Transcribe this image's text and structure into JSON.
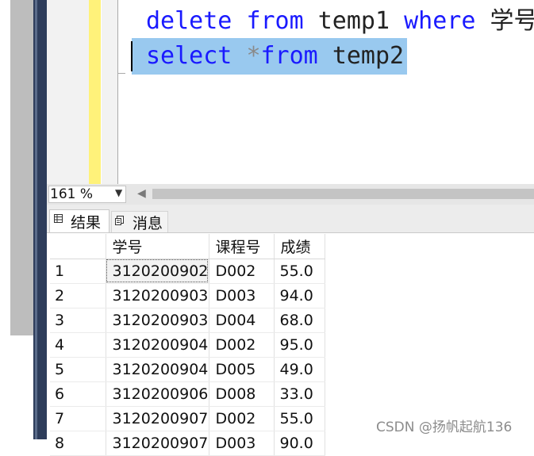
{
  "editor": {
    "line1": {
      "kw1": "delete",
      "kw2": "from",
      "t1": "temp1",
      "kw3": "where",
      "t2": "学号"
    },
    "line2": {
      "kw1": "select",
      "op": "*",
      "kw2": "from",
      "t1": "temp2"
    }
  },
  "status": {
    "zoom": "161 %"
  },
  "tabs": [
    {
      "label": "结果",
      "icon": "grid-icon"
    },
    {
      "label": "消息",
      "icon": "message-icon"
    }
  ],
  "grid": {
    "headers": [
      "",
      "学号",
      "课程号",
      "成绩"
    ],
    "rows": [
      [
        "1",
        "3120200902",
        "D002",
        "55.0"
      ],
      [
        "2",
        "3120200903",
        "D003",
        "94.0"
      ],
      [
        "3",
        "3120200903",
        "D004",
        "68.0"
      ],
      [
        "4",
        "3120200904",
        "D002",
        "95.0"
      ],
      [
        "5",
        "3120200904",
        "D005",
        "49.0"
      ],
      [
        "6",
        "3120200906",
        "D008",
        "33.0"
      ],
      [
        "7",
        "3120200907",
        "D002",
        "55.0"
      ],
      [
        "8",
        "3120200907",
        "D003",
        "90.0"
      ]
    ]
  },
  "watermark": "CSDN @扬帆起航136",
  "colors": {
    "keyword": "#1a1aff",
    "selection": "#99c9ef",
    "gutter_mark": "#fff27a",
    "sidebar": "#2e3d5b"
  }
}
